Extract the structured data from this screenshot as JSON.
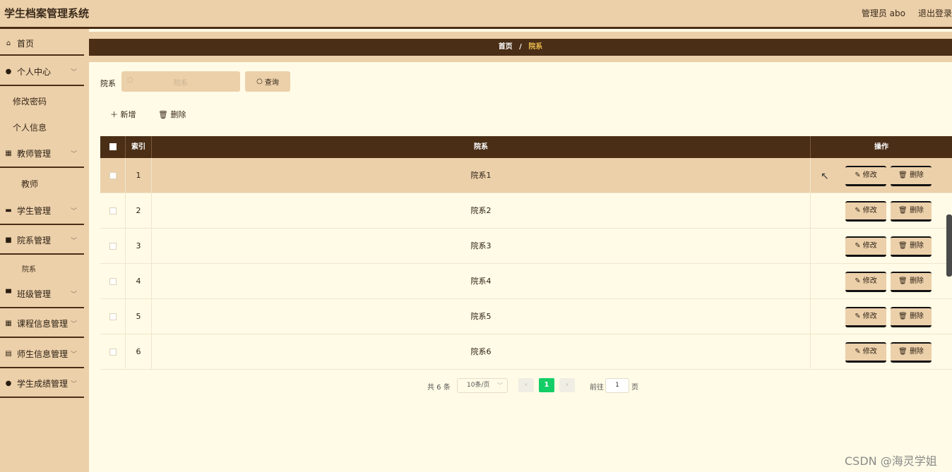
{
  "app": {
    "title": "学生档案管理系统"
  },
  "header": {
    "user": "管理员 abo",
    "logout": "退出登录"
  },
  "sidebar": {
    "items": [
      {
        "label": "首页",
        "icon": "home-icon"
      },
      {
        "label": "个人中心",
        "icon": "user-icon"
      },
      {
        "label": "修改密码"
      },
      {
        "label": "个人信息"
      },
      {
        "label": "教师管理",
        "icon": "grid-icon"
      },
      {
        "label": "教师"
      },
      {
        "label": "学生管理",
        "icon": "ticket-icon"
      },
      {
        "label": "院系管理",
        "icon": "box-icon"
      },
      {
        "label": "院系"
      },
      {
        "label": "班级管理",
        "icon": "briefcase-icon"
      },
      {
        "label": "课程信息管理",
        "icon": "grid-icon"
      },
      {
        "label": "师生信息管理",
        "icon": "chart-icon"
      },
      {
        "label": "学生成绩管理",
        "icon": "pin-icon"
      }
    ]
  },
  "breadcrumb": {
    "home": "首页",
    "sep": "/",
    "current": "院系"
  },
  "search": {
    "label": "院系",
    "placeholder": "院系",
    "button": "查询"
  },
  "toolbar": {
    "add": "新增",
    "delete": "删除"
  },
  "table": {
    "headers": {
      "index": "索引",
      "name": "院系",
      "actions": "操作"
    },
    "rows": [
      {
        "index": "1",
        "name": "院系1"
      },
      {
        "index": "2",
        "name": "院系2"
      },
      {
        "index": "3",
        "name": "院系3"
      },
      {
        "index": "4",
        "name": "院系4"
      },
      {
        "index": "5",
        "name": "院系5"
      },
      {
        "index": "6",
        "name": "院系6"
      }
    ],
    "edit_label": "修改",
    "delete_label": "删除"
  },
  "pagination": {
    "total": "共 6 条",
    "page_size": "10条/页",
    "current": "1",
    "goto": "前往",
    "goto_value": "1",
    "unit": "页"
  },
  "watermark": "CSDN @海灵学姐",
  "colors": {
    "dark_brown": "#4a2e16",
    "tan": "#ecd0aa",
    "cream": "#fffbe6",
    "accent_green": "#13ce66",
    "breadcrumb_current": "#e9b94d"
  }
}
